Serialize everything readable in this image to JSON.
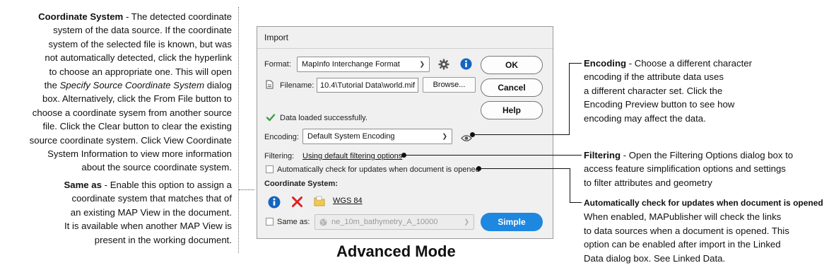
{
  "dialog": {
    "title": "Import",
    "format_label": "Format:",
    "format_value": "MapInfo Interchange Format",
    "filename_label": "Filename:",
    "filename_value": "10.4\\Tutorial Data\\world.mif",
    "browse_label": "Browse...",
    "ok_label": "OK",
    "cancel_label": "Cancel",
    "help_label": "Help",
    "status_text": "Data loaded successfully.",
    "encoding_label": "Encoding:",
    "encoding_value": "Default System Encoding",
    "filtering_label": "Filtering:",
    "filtering_link": "Using default filtering options",
    "auto_check_label": "Automatically check for updates when document is opened",
    "coord_system_header": "Coordinate System:",
    "coord_system_link": "WGS 84",
    "same_as_label": "Same as:",
    "same_as_value": "ne_10m_bathymetry_A_10000",
    "simple_label": "Simple"
  },
  "annotations": {
    "coordinate_system": {
      "title": "Coordinate System",
      "text_1": " - The detected coordinate",
      "line_2": "system of the data source. If the coordinate",
      "line_3": "system of the selected file is known, but was",
      "line_4": "not automatically detected, click the hyperlink",
      "line_5": "to choose an appropriate one. This will open",
      "line_6_pre": "the ",
      "line_6_italic": "Specify Source Coordinate System",
      "line_6_post": " dialog",
      "line_7": "box. Alternatively, click the From File button to",
      "line_8": "choose a coordinate sysem from another source",
      "line_9": "file. Click the Clear button to clear the existing",
      "line_10": "source coordinate system. Click View Coordinate",
      "line_11": "System Information to view more information",
      "line_12": "about the source coordinate system."
    },
    "same_as": {
      "title": "Same as",
      "text_1": " - Enable this option to assign a",
      "line_2": "coordinate system that matches that of",
      "line_3": "an existing MAP View in the document.",
      "line_4": "It is available when another MAP View is",
      "line_5": "present in the working document."
    },
    "encoding": {
      "title": "Encoding",
      "text_1": " - Choose a different character",
      "line_2": "encoding if the attribute data uses",
      "line_3": "a different character set. Click the",
      "line_4": "Encoding Preview button to see how",
      "line_5": "encoding may affect the data."
    },
    "filtering": {
      "title": "Filtering",
      "text_1": " - Open the Filtering Options dialog box to",
      "line_2": "access feature simplification options and settings",
      "line_3": "to filter attributes and geometry"
    },
    "auto_check": {
      "title": "Automatically check for updates when document is opened",
      "line_2": "When enabled, MAPublisher will check the links",
      "line_3": "to data sources when a document is opened. This",
      "line_4": "option can be enabled after import in the Linked",
      "line_5": "Data dialog box. See Linked Data."
    }
  },
  "mode_title": "Advanced Mode",
  "colors": {
    "info_blue": "#1565c0",
    "clear_red": "#e02020",
    "success_green": "#3aa040",
    "simple_button_blue": "#1e87e0",
    "folder_yellow": "#f2c94c"
  },
  "icons": [
    "gear-icon",
    "info-icon",
    "file-icon",
    "check-icon",
    "eye-icon",
    "clear-icon",
    "folder-icon",
    "globe-icon",
    "chevron-down-icon"
  ]
}
